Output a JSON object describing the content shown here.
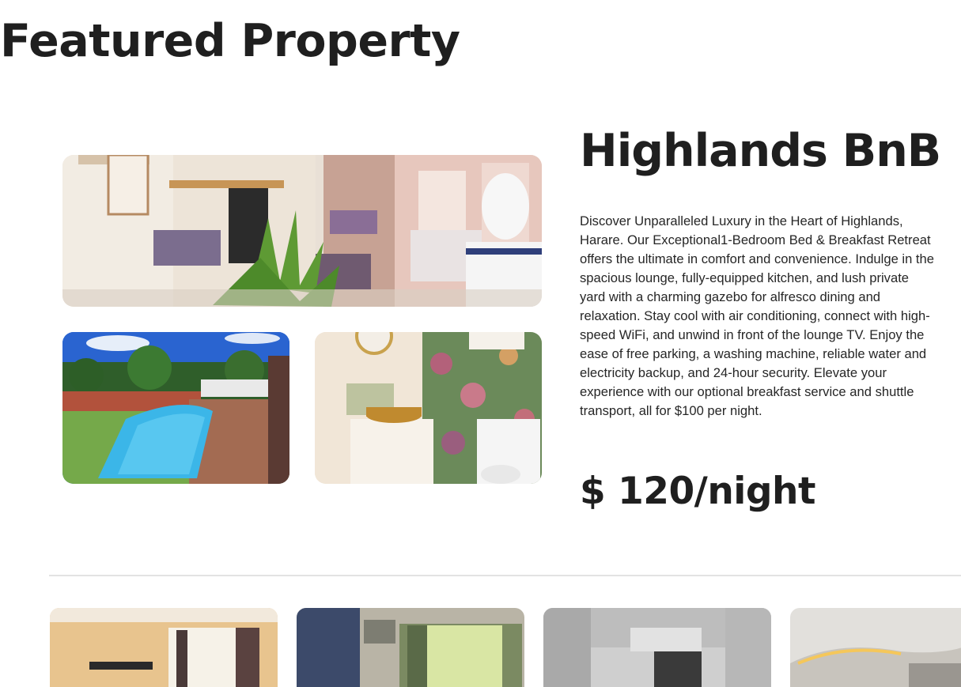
{
  "section": {
    "title": "Featured Property"
  },
  "property": {
    "name": "Highlands BnB",
    "description": "Discover Unparalleled Luxury in the Heart of Highlands, Harare. Our Exceptional1-Bedroom Bed & Breakfast Retreat offers the ultimate in comfort and convenience. Indulge in the spacious lounge, fully-equipped kitchen, and lush private yard with a charming gazebo for alfresco dining and relaxation. Stay cool with air conditioning, connect with high-speed WiFi, and unwind in front of the lounge TV. Enjoy the ease of free parking, a washing machine, reliable water and electricity backup, and 24-hour security. Elevate your experience with our optional breakfast service and shuttle transport, all for $100 per night.",
    "price": "$ 120/night",
    "photos": [
      "lounge-photo",
      "pool-photo",
      "bathroom-photo"
    ]
  },
  "more_properties": {
    "thumbnails": [
      "bedroom-photo",
      "room-window-photo",
      "hallway-photo",
      "ceiling-photo"
    ]
  },
  "colors": {
    "text": "#1f1f1f",
    "divider": "#e3e3e3",
    "background": "#ffffff"
  }
}
